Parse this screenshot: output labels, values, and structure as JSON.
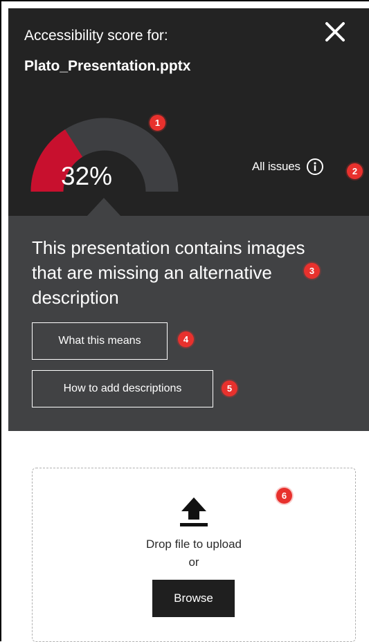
{
  "header": {
    "heading": "Accessibility score for:",
    "file_name": "Plato_Presentation.pptx",
    "close_icon": "close-icon"
  },
  "score": {
    "value": 0.32,
    "label": "32%",
    "fill_color": "#c8102e",
    "track_color": "#3e3f42"
  },
  "all_issues": {
    "label": "All issues",
    "icon": "info-icon"
  },
  "issue": {
    "message": "This presentation contains images that are missing an alternative description",
    "buttons": {
      "what_means": "What this means",
      "how_to_add": "How to add descriptions"
    }
  },
  "upload": {
    "icon": "upload-icon",
    "drop_text": "Drop file to upload",
    "or_text": "or",
    "browse_label": "Browse"
  },
  "callouts": [
    "1",
    "2",
    "3",
    "4",
    "5",
    "6"
  ],
  "colors": {
    "header_bg": "#232323",
    "detail_bg": "#414244",
    "badge": "#e8312d"
  }
}
